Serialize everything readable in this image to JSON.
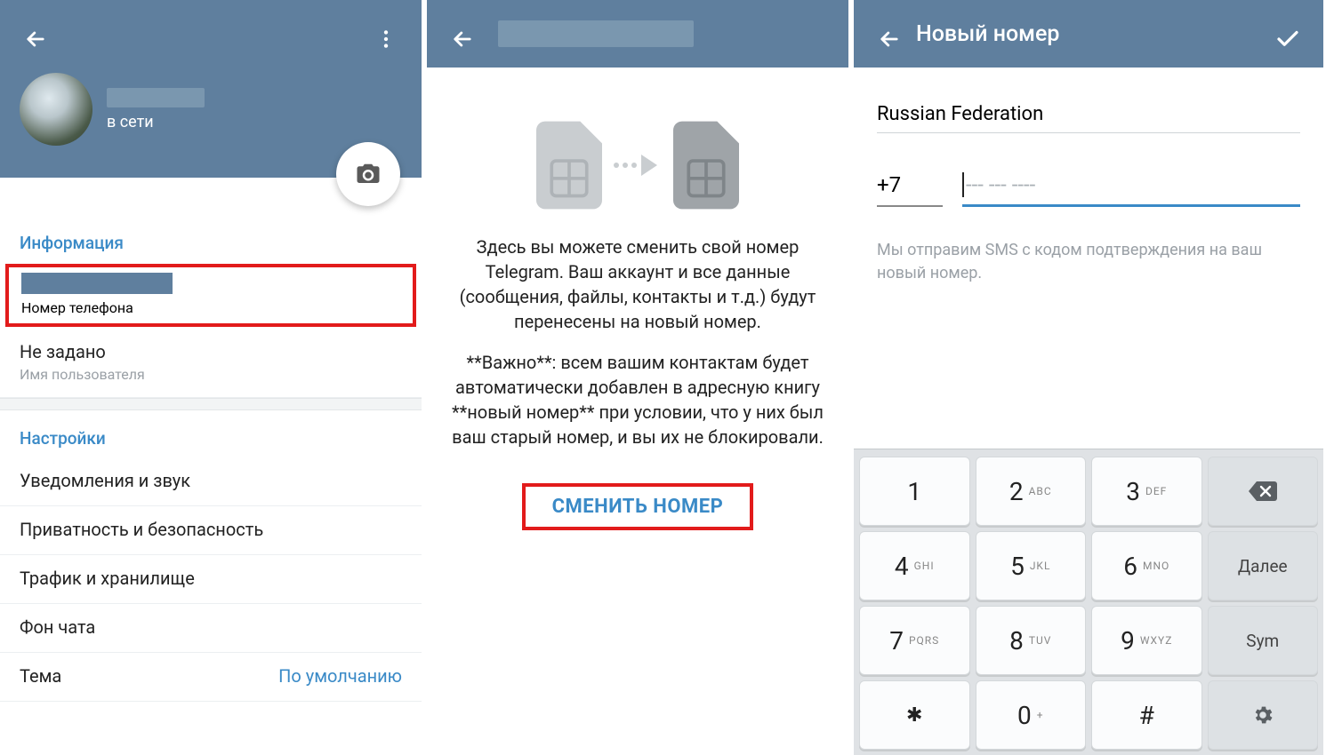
{
  "screen1": {
    "status": "в сети",
    "section_info": "Информация",
    "phone_label": "Номер телефона",
    "username_value": "Не задано",
    "username_label": "Имя пользователя",
    "section_settings": "Настройки",
    "notifications": "Уведомления и звук",
    "privacy": "Приватность и безопасность",
    "data": "Трафик и хранилище",
    "background": "Фон чата",
    "theme_label": "Тема",
    "theme_value": "По умолчанию"
  },
  "screen2": {
    "para1": "Здесь вы можете сменить свой номер Telegram. Ваш аккаунт и все данные (сообщения,\nфайлы, контакты и т.д.) будут перенесены на новый номер.",
    "para2": "**Важно**: всем вашим контактам будет автоматически добавлен в адресную книгу **новый номер** при условии, что у них был ваш старый номер, и вы их не блокировали.",
    "button": "СМЕНИТЬ НОМЕР"
  },
  "screen3": {
    "title": "Новый номер",
    "country": "Russian Federation",
    "prefix": "+7",
    "placeholder": "--- --- ----",
    "hint": "Мы отправим SMS с кодом подтверждения на ваш новый номер.",
    "keys": {
      "k1": "1",
      "k2": "2",
      "k2s": "ABC",
      "k3": "3",
      "k3s": "DEF",
      "k4": "4",
      "k4s": "GHI",
      "k5": "5",
      "k5s": "JKL",
      "k6": "6",
      "k6s": "MNO",
      "next": "Далее",
      "k7": "7",
      "k7s": "PQRS",
      "k8": "8",
      "k8s": "TUV",
      "k9": "9",
      "k9s": "WXYZ",
      "sym": "Sym",
      "star": "✱",
      "k0": "0",
      "k0s": "+",
      "hash": "#"
    }
  }
}
